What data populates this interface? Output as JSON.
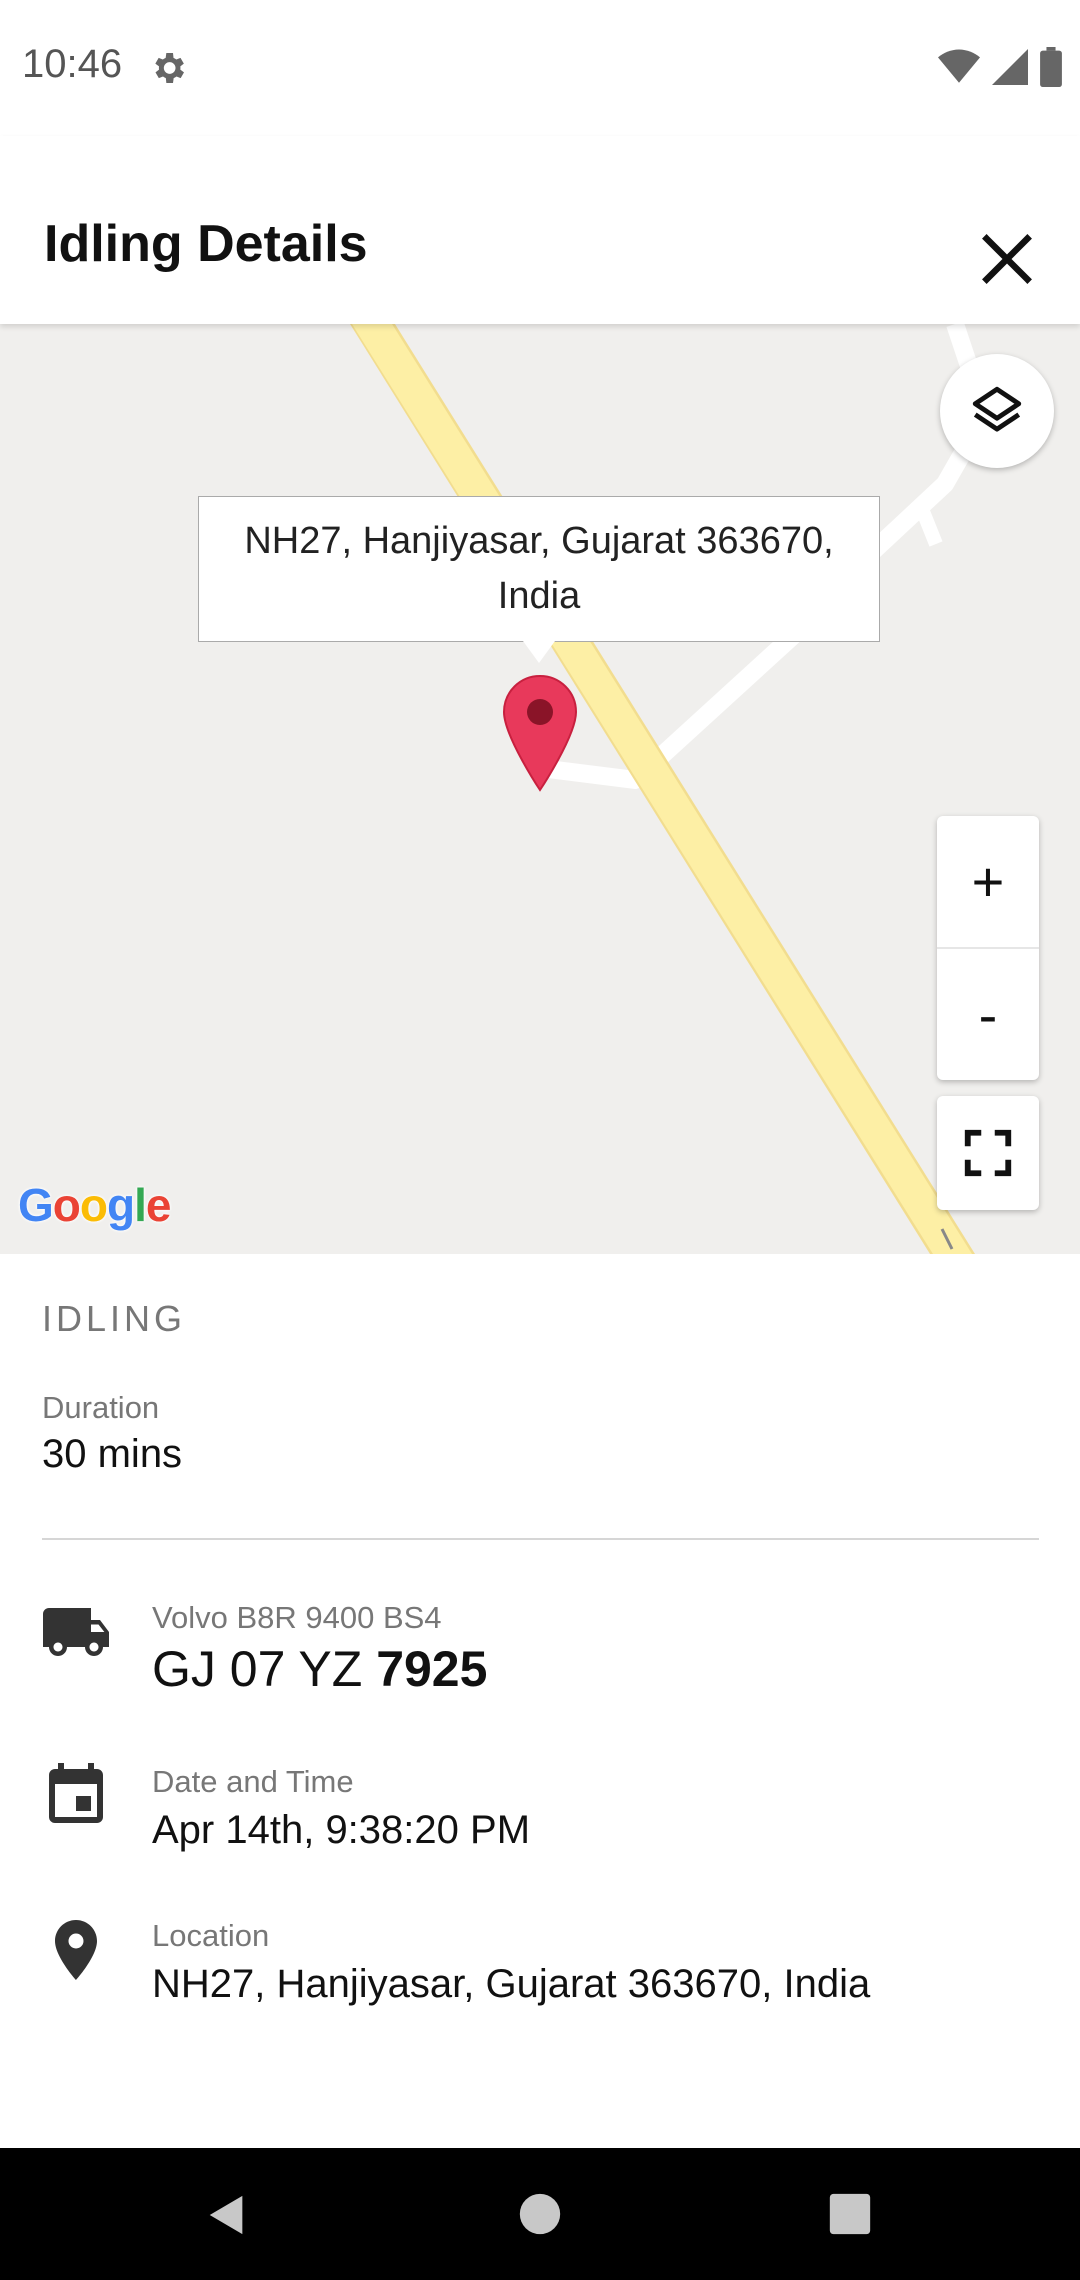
{
  "status_bar": {
    "time": "10:46"
  },
  "header": {
    "title": "Idling Details"
  },
  "map": {
    "callout_text": "NH27, Hanjiyasar, Gujarat 363670, India",
    "zoom_in_label": "+",
    "zoom_out_label": "-",
    "attribution": "Google",
    "pin_color": "#e8395b",
    "road_color": "#fdefa5"
  },
  "details": {
    "section_label": "IDLING",
    "duration_label": "Duration",
    "duration_value": "30 mins",
    "vehicle": {
      "model": "Volvo B8R 9400 BS4",
      "plate_prefix": "GJ 07 YZ",
      "plate_number": "7925"
    },
    "datetime": {
      "label": "Date and Time",
      "value": "Apr 14th, 9:38:20 PM"
    },
    "location": {
      "label": "Location",
      "value": "NH27, Hanjiyasar, Gujarat 363670, India"
    }
  }
}
